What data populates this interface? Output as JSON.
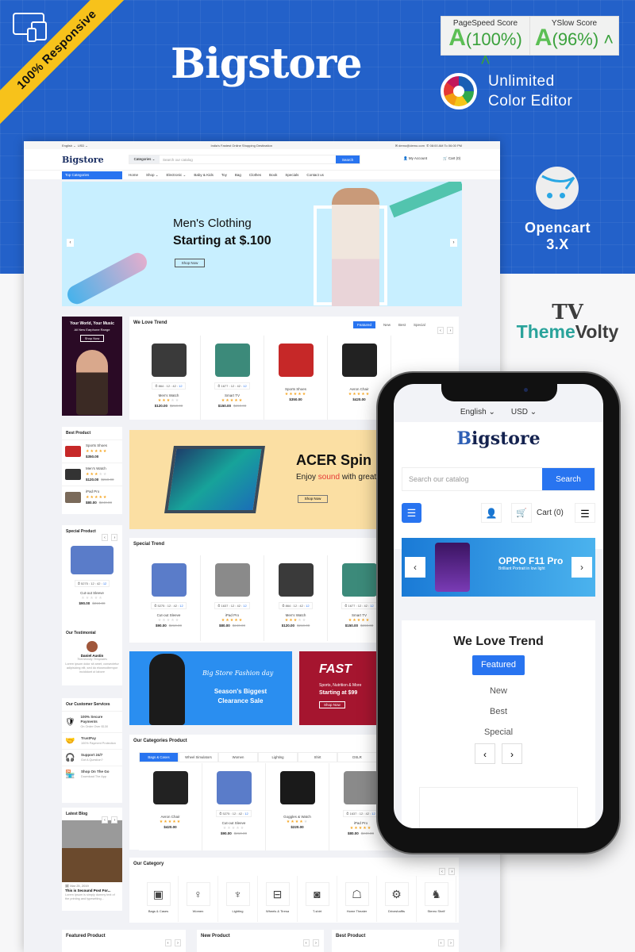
{
  "promo": {
    "ribbon": "100% Responsive",
    "brand": "Bigstore",
    "scores": [
      {
        "label": "PageSpeed Score",
        "grade": "A",
        "value": "(100%)"
      },
      {
        "label": "YSlow Score",
        "grade": "A",
        "value": "(96%)"
      }
    ],
    "color_editor": [
      "Unlimited",
      "Color Editor"
    ],
    "platform": [
      "Opencart",
      "3.X"
    ],
    "vendor": {
      "mark": "TV",
      "name_a": "Theme",
      "name_b": "Volty"
    }
  },
  "desktop": {
    "topbar": {
      "language": "English ⌄",
      "currency": "USD ⌄",
      "tagline": "India's Fastest Online Shopping Destination",
      "email": "✉ demo@demo.com",
      "hours": "✆ 08:00 AM To 06:00 PM"
    },
    "header": {
      "logo": "Bigstore",
      "categories": "Categories ⌄",
      "search_placeholder": "Search our catalog",
      "search_button": "Search",
      "account": "My Account",
      "cart": "Cart (0)"
    },
    "nav": {
      "top_categories": "Top Categories",
      "items": [
        "Home",
        "Shop ⌄",
        "Electronic ⌄",
        "Baby & Kids",
        "Toy",
        "Bag",
        "Clothes",
        "Book",
        "Specials",
        "Contact us"
      ]
    },
    "slider": {
      "title": "Men's Clothing",
      "subtitle": "Starting at $.100",
      "button": "Shop Now"
    },
    "left_banner": {
      "title": "Your World, Your Music",
      "subtitle": "All New Earphone Range",
      "button": "Shop Now"
    },
    "trend": {
      "title": "We Love Trend",
      "tabs": [
        "Featured",
        "New",
        "Best",
        "Special"
      ],
      "products": [
        {
          "name": "Men's Watch",
          "timer": [
            "864",
            "12",
            "42",
            "12"
          ],
          "rating": 3,
          "price": "$120.00",
          "old": "$210.00",
          "color": "#3a3a3a"
        },
        {
          "name": "Smart TV",
          "timer": [
            "1677",
            "12",
            "42",
            "12"
          ],
          "rating": 5,
          "price": "$150.00",
          "old": "$260.00",
          "color": "#3c8a7a"
        },
        {
          "name": "Sports Shoes",
          "timer": null,
          "rating": 5,
          "price": "$350.00",
          "old": "",
          "color": "#c62828"
        },
        {
          "name": "Aeron Chair",
          "timer": null,
          "rating": 5,
          "price": "$420.00",
          "old": "",
          "color": "#222"
        }
      ]
    },
    "best_product": {
      "title": "Best Product",
      "items": [
        {
          "name": "Sports Shoes",
          "rating": 5,
          "price": "$350.00",
          "old": "",
          "color": "#c62828"
        },
        {
          "name": "Men's Watch",
          "rating": 3,
          "price": "$120.00",
          "old": "$210.00",
          "color": "#333"
        },
        {
          "name": "iPad Pro",
          "rating": 5,
          "price": "$80.00",
          "old": "$240.00",
          "color": "#7a6a5a"
        }
      ]
    },
    "acer": {
      "title": "ACER Spin",
      "sub_a": "Enjoy ",
      "sub_b": "sound",
      "sub_c": " with great",
      "button": "Shop Now"
    },
    "special_product": {
      "title": "Special Product",
      "name": "Cut-out Sleeve",
      "timer": [
        "5275",
        "12",
        "42",
        "12"
      ],
      "rating": 0,
      "price": "$90.00",
      "old": "$210.00"
    },
    "special_trend": {
      "title": "Special Trend",
      "products": [
        {
          "name": "Cut-out Sleeve",
          "timer": [
            "5275",
            "12",
            "42",
            "12"
          ],
          "rating": 0,
          "price": "$90.00",
          "old": "$210.00",
          "color": "#5a7cc9"
        },
        {
          "name": "iPad Pro",
          "timer": [
            "1637",
            "12",
            "42",
            "12"
          ],
          "rating": 5,
          "price": "$80.00",
          "old": "$240.00",
          "color": "#8a8a8a"
        },
        {
          "name": "Men's Watch",
          "timer": [
            "864",
            "12",
            "42",
            "12"
          ],
          "rating": 3,
          "price": "$120.00",
          "old": "$210.00",
          "color": "#3a3a3a"
        },
        {
          "name": "Smart TV",
          "timer": [
            "1677",
            "12",
            "42",
            "12"
          ],
          "rating": 5,
          "price": "$150.00",
          "old": "$260.00",
          "color": "#3c8a7a"
        }
      ]
    },
    "testimonial": {
      "title": "Our Testimonial",
      "name": "Daniel Austin",
      "role": "Themevolty Templates",
      "text": "Lorem ipsum dolor sit amet, consectetur adipisicing elit, sed do eiusmodtempor incididunt ut labore"
    },
    "fashion": {
      "line1": "Big Store Fashion day",
      "line2": "Season's Biggest",
      "line3": "Clearance Sale"
    },
    "fast": {
      "logo": "FAST",
      "line1": "Sports, Nutrition & More",
      "line2": "Starting at $99",
      "button": "Shop Now"
    },
    "services": {
      "title": "Our Customer Services",
      "items": [
        {
          "title": "100% Secure Payments",
          "sub": "On Order Over $130"
        },
        {
          "title": "TrustPay",
          "sub": "100% Payment Protection"
        },
        {
          "title": "Support 24/7",
          "sub": "Got A Question?"
        },
        {
          "title": "Shop On The Go",
          "sub": "Download The App"
        }
      ]
    },
    "categories_product": {
      "title": "Our Categories Product",
      "tabs": [
        "Bags & Cases",
        "Wheel Simulators",
        "Women",
        "Lighting",
        "Shirt",
        "DSLR"
      ],
      "products": [
        {
          "name": "Aeron Chair",
          "timer": null,
          "rating": 5,
          "price": "$420.00",
          "old": "",
          "color": "#222"
        },
        {
          "name": "Cut-out Sleeve",
          "timer": [
            "5275",
            "12",
            "42",
            "12"
          ],
          "rating": 0,
          "price": "$90.00",
          "old": "$210.00",
          "color": "#5a7cc9"
        },
        {
          "name": "Goggles & Watch",
          "timer": null,
          "rating": 4,
          "price": "$220.00",
          "old": "",
          "color": "#1a1a1a"
        },
        {
          "name": "iPad Pro",
          "timer": [
            "1637",
            "12",
            "42",
            "12"
          ],
          "rating": 5,
          "price": "$80.00",
          "old": "$240.00",
          "color": "#8a8a8a"
        }
      ]
    },
    "blog": {
      "title": "Latest Blog",
      "date": "Mar 25, 2019",
      "post": "This is Secound Post For...",
      "excerpt": "Lorem Ipsum is simply dummy text of the printing and typesetting..."
    },
    "our_category": {
      "title": "Our Category",
      "items": [
        {
          "name": "Bags & Cases",
          "icon": "▣"
        },
        {
          "name": "Women",
          "icon": "♀"
        },
        {
          "name": "Lighting",
          "icon": "♆"
        },
        {
          "name": "Wheels & Tiresa",
          "icon": "⊟"
        },
        {
          "name": "T-shirt",
          "icon": "◙"
        },
        {
          "name": "Home Theater",
          "icon": "☖"
        },
        {
          "name": "Driveshaffts",
          "icon": "⚙"
        },
        {
          "name": "Stereo Shelf",
          "icon": "♞"
        }
      ]
    },
    "bottom_titles": [
      "Featured Product",
      "New Product",
      "Best Product"
    ]
  },
  "mobile": {
    "language": "English ⌄",
    "currency": "USD ⌄",
    "logo_a": "B",
    "logo_b": "igstore",
    "search_placeholder": "Search our catalog",
    "search_button": "Search",
    "cart": "Cart (0)",
    "banner": {
      "title": "OPPO F11 Pro",
      "subtitle": "Brilliant Portrait in low light"
    },
    "trend": {
      "title": "We Love Trend",
      "tabs": [
        "Featured",
        "New",
        "Best",
        "Special"
      ]
    }
  }
}
